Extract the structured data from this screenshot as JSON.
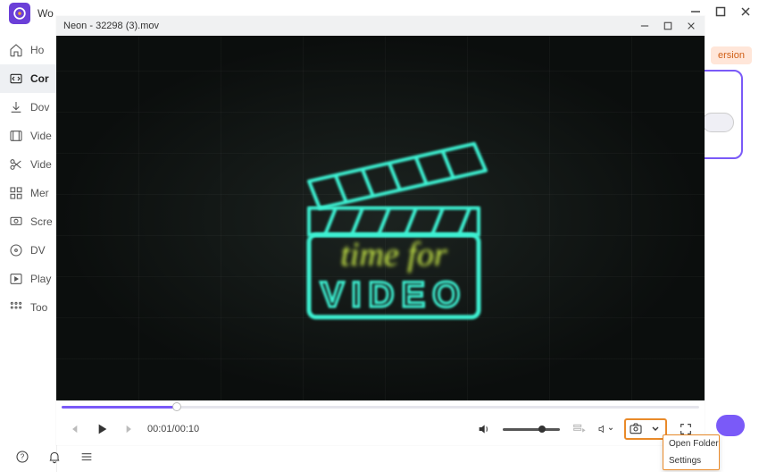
{
  "app": {
    "title": "Wo",
    "badge": "ersion"
  },
  "sidebar": {
    "items": [
      {
        "icon": "home",
        "label": "Ho"
      },
      {
        "icon": "convert",
        "label": "Cor"
      },
      {
        "icon": "download",
        "label": "Dov"
      },
      {
        "icon": "film",
        "label": "Vide"
      },
      {
        "icon": "scissors",
        "label": "Vide"
      },
      {
        "icon": "grid",
        "label": "Mer"
      },
      {
        "icon": "record",
        "label": "Scre"
      },
      {
        "icon": "disc",
        "label": "DV"
      },
      {
        "icon": "play",
        "label": "Play"
      },
      {
        "icon": "tools",
        "label": "Too"
      }
    ],
    "active_index": 1
  },
  "player": {
    "title": "Neon - 32298 (3).mov",
    "content_line1": "time for",
    "content_line2": "VIDEO",
    "progress_pct": 18,
    "time_current": "00:01",
    "time_total": "00:10",
    "volume_pct": 68
  },
  "dropdown": {
    "items": [
      "Open Folder",
      "Settings"
    ]
  },
  "icons": {
    "home": "home",
    "convert": "convert",
    "download": "download",
    "film": "film",
    "scissors": "scissors",
    "grid": "grid",
    "record": "record",
    "disc": "disc",
    "play": "play",
    "tools": "tools"
  }
}
